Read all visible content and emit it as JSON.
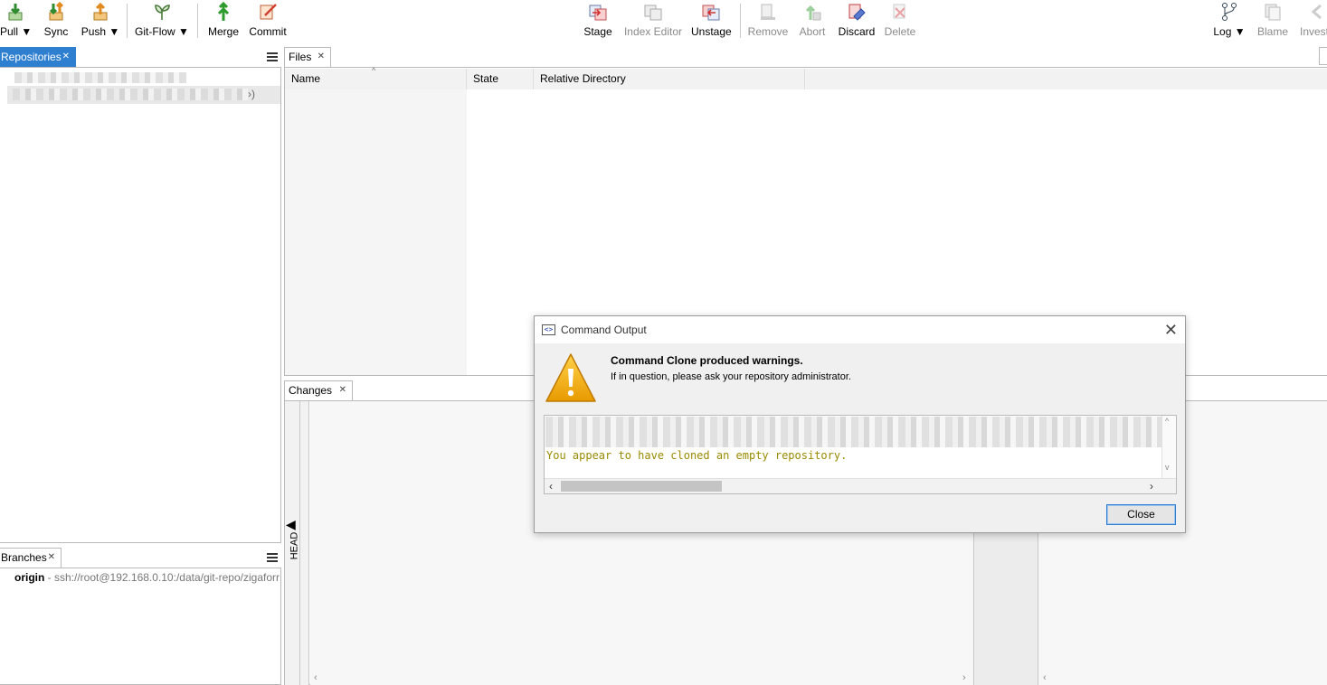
{
  "toolbar": {
    "pull": "Pull ▼",
    "sync": "Sync",
    "push": "Push ▼",
    "gitflow": "Git-Flow ▼",
    "merge": "Merge",
    "commit": "Commit",
    "stage": "Stage",
    "index_editor": "Index Editor",
    "unstage": "Unstage",
    "remove": "Remove",
    "abort": "Abort",
    "discard": "Discard",
    "delete": "Delete",
    "log": "Log ▼",
    "blame": "Blame",
    "investigate": "Invest"
  },
  "repositories": {
    "tab": "Repositories",
    "items": []
  },
  "branches": {
    "tab": "Branches",
    "remote_name": "origin",
    "remote_url": "- ssh://root@192.168.0.10:/data/git-repo/zigaforr"
  },
  "files": {
    "tab": "Files",
    "columns": [
      "Name",
      "State",
      "Relative Directory"
    ]
  },
  "changes": {
    "tab": "Changes",
    "head_label": "HEAD"
  },
  "dialog": {
    "title": "Command Output",
    "heading": "Command Clone produced warnings.",
    "subtext": "If in question, please ask your repository administrator.",
    "output_line": "You appear to have cloned an empty repository.",
    "close_button": "Close"
  },
  "colors": {
    "accent": "#2f7fd1",
    "warning": "#f0a000",
    "output_text": "#9a8a00"
  }
}
